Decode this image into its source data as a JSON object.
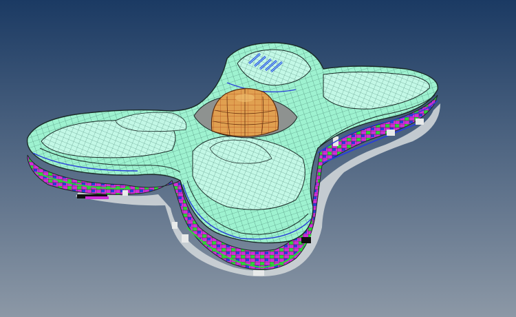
{
  "scene": {
    "subject": "",
    "colors": {
      "bg_top": "#1b3a63",
      "bg_bottom": "#8c98a6",
      "roof": "#9ef2d0",
      "roof_light": "#c3f8e6",
      "mesh": "#3d7a68",
      "outline": "#1a2a26",
      "facade_magenta": "#d12ed8",
      "facade_green": "#2fd23a",
      "facade_blue": "#2a3fd8",
      "dome": "#e0a050",
      "dome_mesh": "#b24a1c",
      "courtyard": "#8e9290",
      "base_shadow": "#cfd5d8"
    }
  }
}
